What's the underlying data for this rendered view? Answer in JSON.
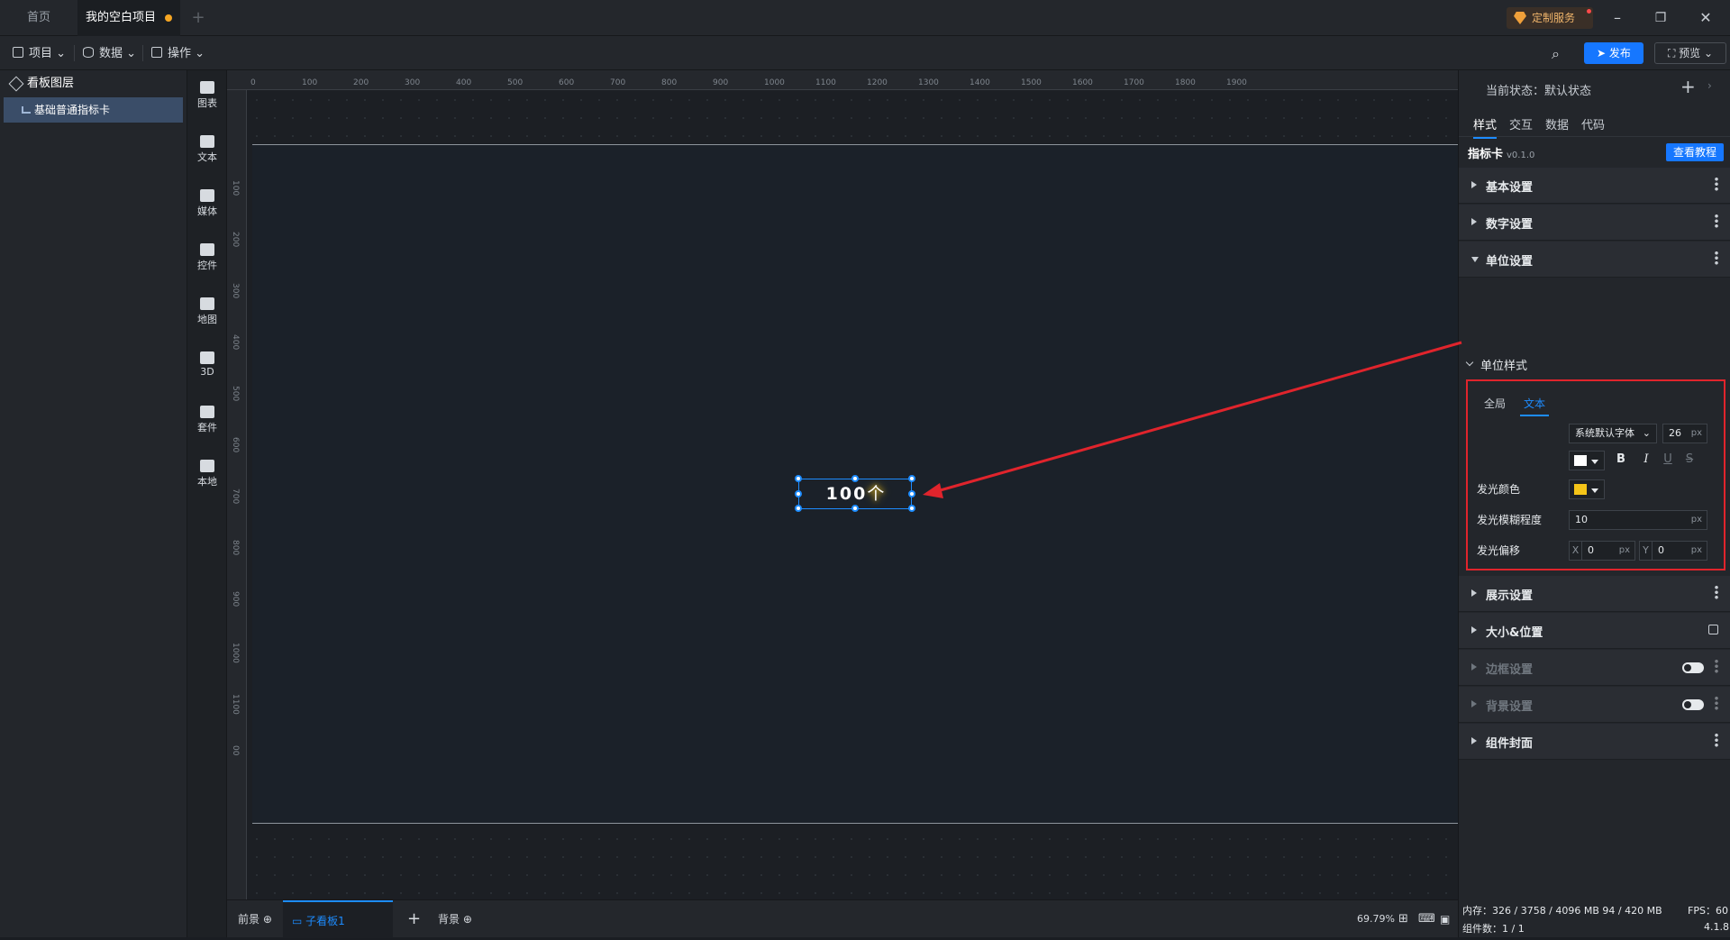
{
  "tabs": {
    "home": "首页",
    "project": "我的空白项目"
  },
  "service": "定制服务",
  "menus": {
    "project": "项目",
    "data": "数据",
    "operate": "操作"
  },
  "toolbar": {
    "publish": "发布",
    "preview": "预览"
  },
  "layers": {
    "title": "看板图层",
    "item": "基础普通指标卡"
  },
  "tools": [
    "图表",
    "文本",
    "媒体",
    "控件",
    "地图",
    "3D",
    "套件",
    "本地"
  ],
  "ruler": {
    "top": [
      "0",
      "100",
      "200",
      "300",
      "400",
      "500",
      "600",
      "700",
      "800",
      "900",
      "1000",
      "1100",
      "1200",
      "1300",
      "1400",
      "1500",
      "1600",
      "1700",
      "1800",
      "1900"
    ],
    "left": [
      "100",
      "200",
      "300",
      "400",
      "500",
      "600",
      "700",
      "800",
      "900",
      "1000",
      "1100",
      "00"
    ]
  },
  "widget": {
    "value": "100",
    "unit": "个"
  },
  "bottom": {
    "front": "前景",
    "sub": "子看板1",
    "bg": "背景",
    "zoom": "69.79%"
  },
  "right": {
    "state": "当前状态：默认状态",
    "tabs": [
      "样式",
      "交互",
      "数据",
      "代码"
    ],
    "card_title": "指标卡",
    "card_version": "v0.1.0",
    "tutorial": "查看教程",
    "sections": {
      "basic": "基本设置",
      "number": "数字设置",
      "unit": "单位设置",
      "display": "展示设置",
      "size": "大小&位置",
      "border": "边框设置",
      "background": "背景设置",
      "cover": "组件封面"
    },
    "unit_style": "单位样式",
    "subtabs": {
      "global": "全局",
      "text": "文本"
    },
    "font_family": "系统默认字体",
    "font_size": "26",
    "px": "px",
    "glow_color_label": "发光颜色",
    "glow_blur_label": "发光模糊程度",
    "glow_blur": "10",
    "glow_offset_label": "发光偏移",
    "offset_x_label": "X",
    "offset_x": "0",
    "offset_y_label": "Y",
    "offset_y": "0",
    "fmt": {
      "bold": "B",
      "italic": "I",
      "underline": "U",
      "strike": "S"
    }
  },
  "status": {
    "memory": "内存：326 / 3758 / 4096 MB  94 / 420 MB",
    "fps": "FPS：60",
    "components": "组件数：1 / 1",
    "version": "4.1.8"
  },
  "colors": {
    "accent": "#1677ff",
    "glow": "#f5c518",
    "annotation": "#e0242c"
  }
}
